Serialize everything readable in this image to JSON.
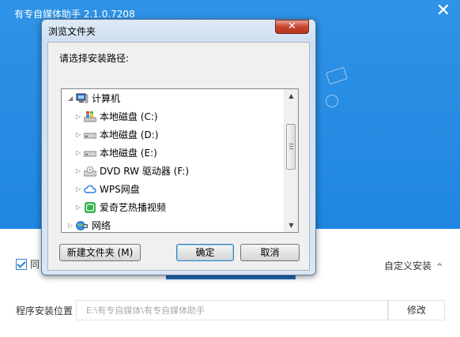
{
  "app": {
    "title": "有专自媒体助手  2.1.0.7208",
    "close_glyph": "✕"
  },
  "installer": {
    "agree_text": "同",
    "custom_install_label": "自定义安装",
    "custom_install_chevron": "^",
    "path_label": "程序安装位置",
    "path_value": "E:\\有专自媒体\\有专自媒体助手",
    "modify_button": "修改"
  },
  "dialog": {
    "title": "浏览文件夹",
    "close_glyph": "✕",
    "prompt": "请选择安装路径:",
    "tree": [
      {
        "label": "计算机",
        "icon": "computer-icon",
        "expanded": true
      },
      {
        "label": "本地磁盘 (C:)",
        "icon": "windows-drive-icon",
        "expanded": false
      },
      {
        "label": "本地磁盘 (D:)",
        "icon": "drive-icon",
        "expanded": false
      },
      {
        "label": "本地磁盘 (E:)",
        "icon": "drive-icon",
        "expanded": false
      },
      {
        "label": "DVD RW 驱动器 (F:)",
        "icon": "dvd-drive-icon",
        "expanded": false
      },
      {
        "label": "WPS网盘",
        "icon": "cloud-icon",
        "expanded": false
      },
      {
        "label": "爱奇艺热播视频",
        "icon": "iqiyi-icon",
        "expanded": false
      },
      {
        "label": "网络",
        "icon": "network-icon",
        "expanded": false
      }
    ],
    "new_folder_button": "新建文件夹 (M)",
    "ok_button": "确定",
    "cancel_button": "取消"
  },
  "colors": {
    "banner": "#1f86e0",
    "dialog_frame": "#cfdff0",
    "close_button": "#c7442e"
  }
}
